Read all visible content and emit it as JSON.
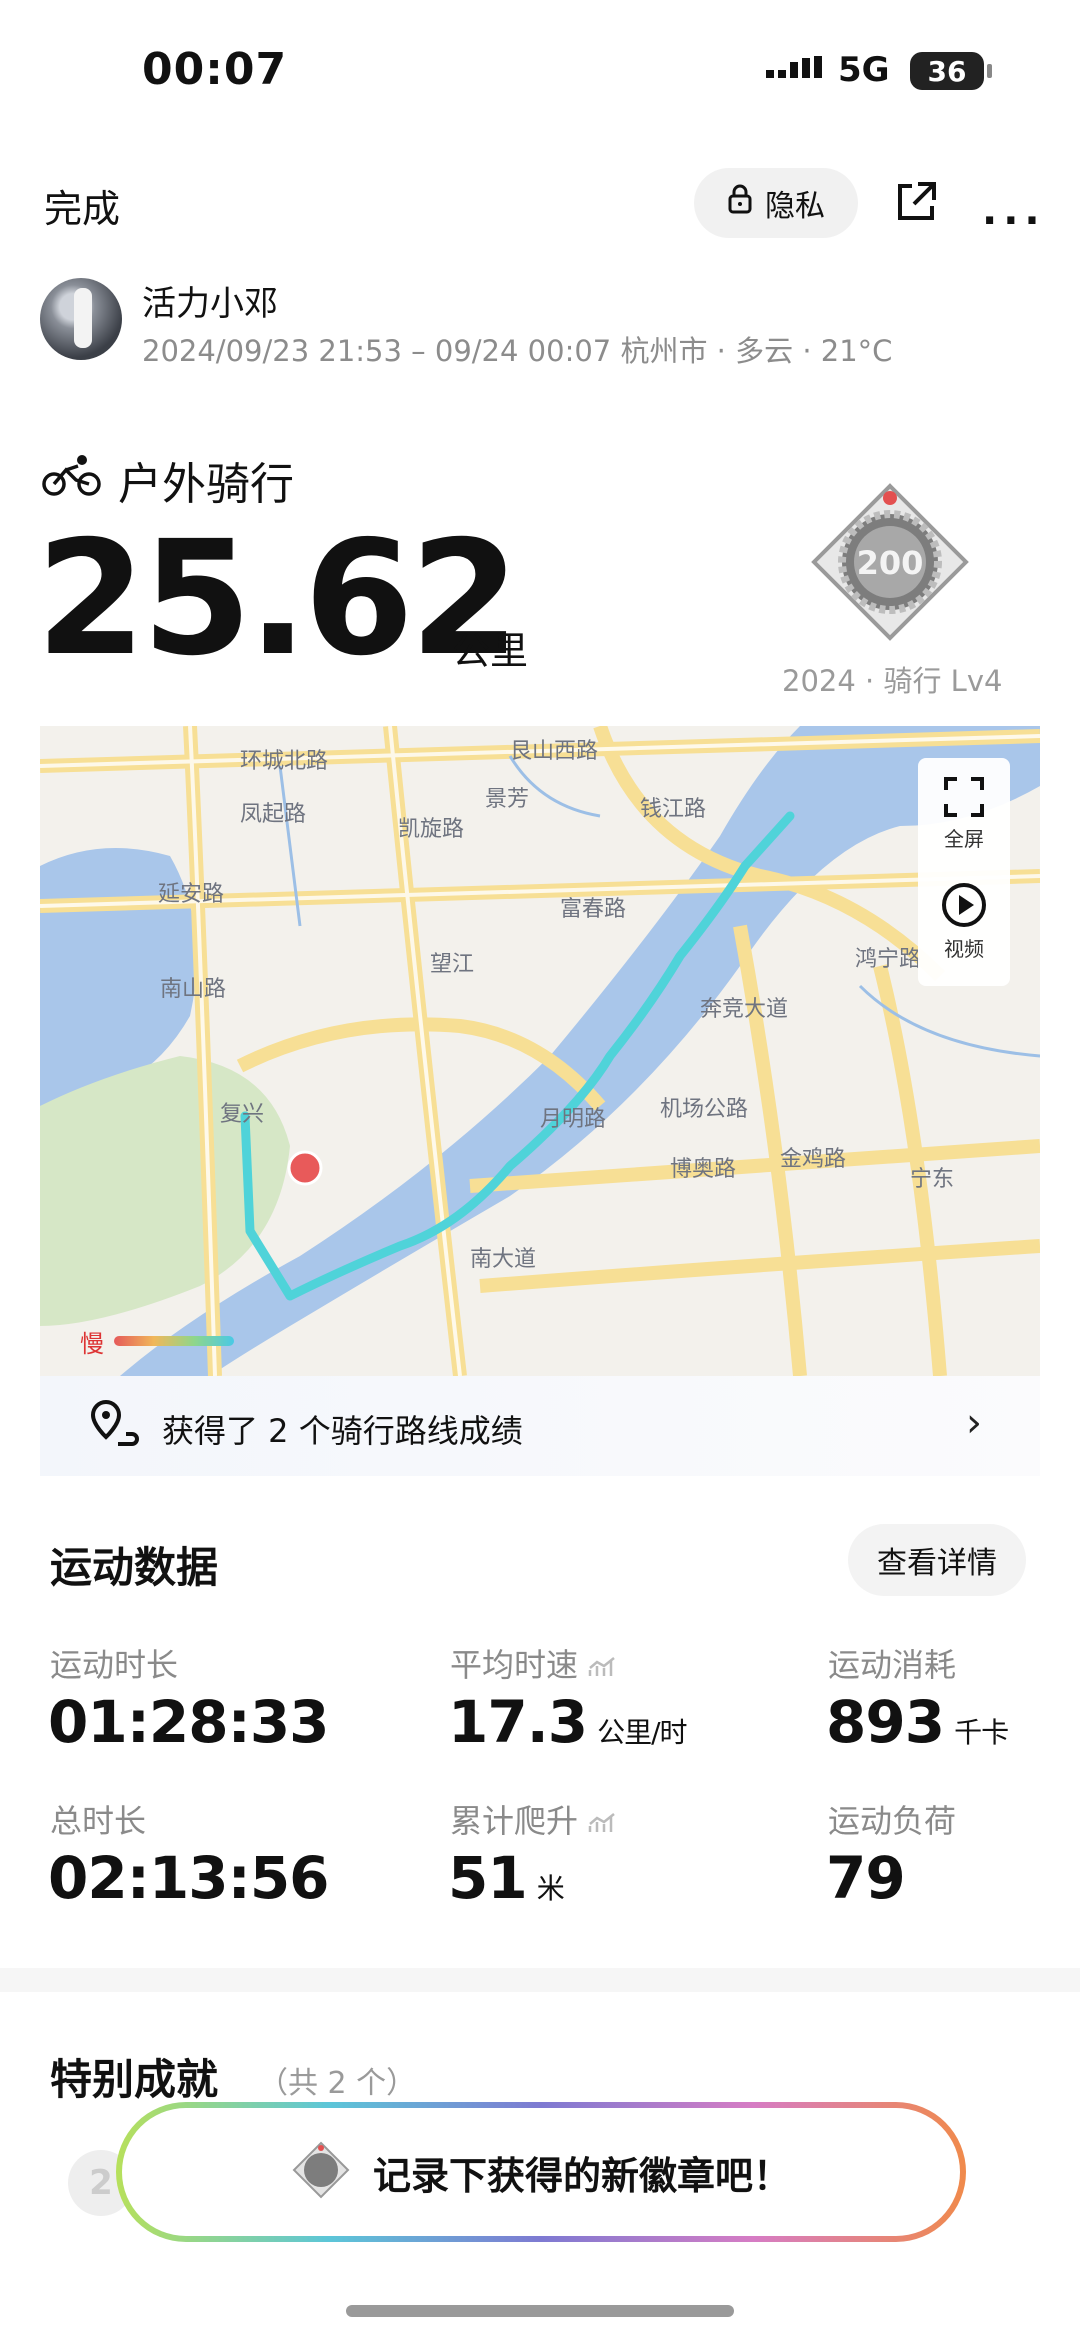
{
  "status_bar": {
    "time": "00:07",
    "network": "5G",
    "battery": "36"
  },
  "top_bar": {
    "done_label": "完成",
    "privacy_label": "隐私"
  },
  "user": {
    "name": "活力小邓",
    "meta": "2024/09/23 21:53 – 09/24 00:07 杭州市 · 多云 · 21°C"
  },
  "activity": {
    "type": "户外骑行",
    "distance": "25.62",
    "distance_unit": "公里",
    "badge_caption": "2024 · 骑行 Lv4",
    "badge_number": "200"
  },
  "map": {
    "fullscreen_label": "全屏",
    "video_label": "视频",
    "slow_label": "慢",
    "labels": [
      "环城北路",
      "艮山西路",
      "凤起路",
      "景芳",
      "凯旋路",
      "钱江路",
      "延安路",
      "南山路",
      "望江",
      "富春路",
      "鸿宁路",
      "奔竞大道",
      "机场公路",
      "复兴",
      "月明路",
      "博奥路",
      "金鸡路",
      "宁东",
      "南大道"
    ]
  },
  "route_banner": {
    "text": "获得了 2 个骑行路线成绩"
  },
  "stats": {
    "title": "运动数据",
    "details_label": "查看详情",
    "items": [
      {
        "label": "运动时长",
        "value": "01:28:33",
        "unit": ""
      },
      {
        "label": "平均时速",
        "value": "17.3",
        "unit": "公里/时"
      },
      {
        "label": "运动消耗",
        "value": "893",
        "unit": "千卡"
      },
      {
        "label": "总时长",
        "value": "02:13:56",
        "unit": ""
      },
      {
        "label": "累计爬升",
        "value": "51",
        "unit": "米"
      },
      {
        "label": "运动负荷",
        "value": "79",
        "unit": ""
      }
    ]
  },
  "achievements": {
    "title": "特别成就",
    "count": "（共 2 个）",
    "medal_number": "2"
  },
  "toast": {
    "text": "记录下获得的新徽章吧！"
  },
  "colors": {
    "route": "#4fd3d9",
    "river": "#a9c6ea",
    "road": "#f7df95",
    "park": "#d6e7c6",
    "marker": "#e85a5a"
  }
}
